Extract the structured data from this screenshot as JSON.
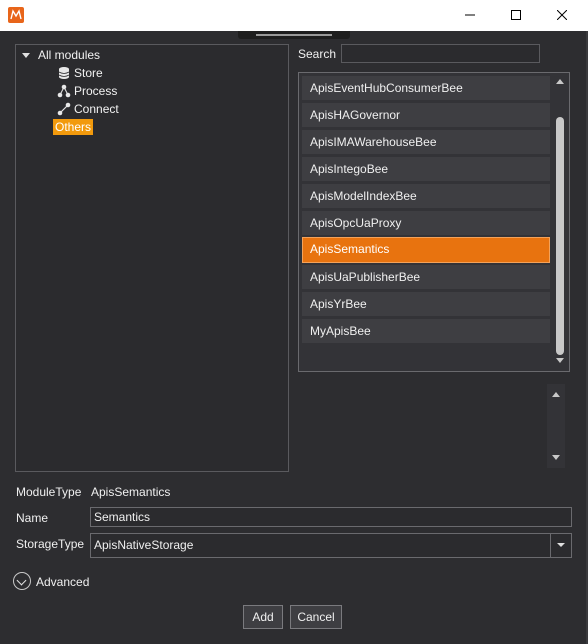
{
  "window": {
    "app_icon": "apis-logo-icon",
    "minimize_icon": "minimize-icon",
    "maximize_icon": "maximize-icon",
    "close_icon": "close-icon"
  },
  "tree": {
    "root_label": "All modules",
    "nodes": [
      {
        "label": "Store",
        "icon": "database-icon"
      },
      {
        "label": "Process",
        "icon": "process-icon"
      },
      {
        "label": "Connect",
        "icon": "connect-icon"
      },
      {
        "label": "Others",
        "icon": ""
      }
    ],
    "selected": "Others"
  },
  "search": {
    "label": "Search",
    "value": ""
  },
  "modules": {
    "items": [
      "ApisEventHubConsumerBee",
      "ApisHAGovernor",
      "ApisIMAWarehouseBee",
      "ApisIntegoBee",
      "ApisModelIndexBee",
      "ApisOpcUaProxy",
      "ApisSemantics",
      "ApisUaPublisherBee",
      "ApisYrBee",
      "MyApisBee"
    ],
    "selected": "ApisSemantics"
  },
  "form": {
    "module_type_label": "ModuleType",
    "module_type_value": "ApisSemantics",
    "name_label": "Name",
    "name_value": "Semantics",
    "storage_type_label": "StorageType",
    "storage_type_value": "ApisNativeStorage"
  },
  "advanced": {
    "label": "Advanced"
  },
  "buttons": {
    "add": "Add",
    "cancel": "Cancel"
  },
  "colors": {
    "accent": "#e8730f",
    "tree_selection": "#f29a0d",
    "background": "#2d2d30"
  }
}
